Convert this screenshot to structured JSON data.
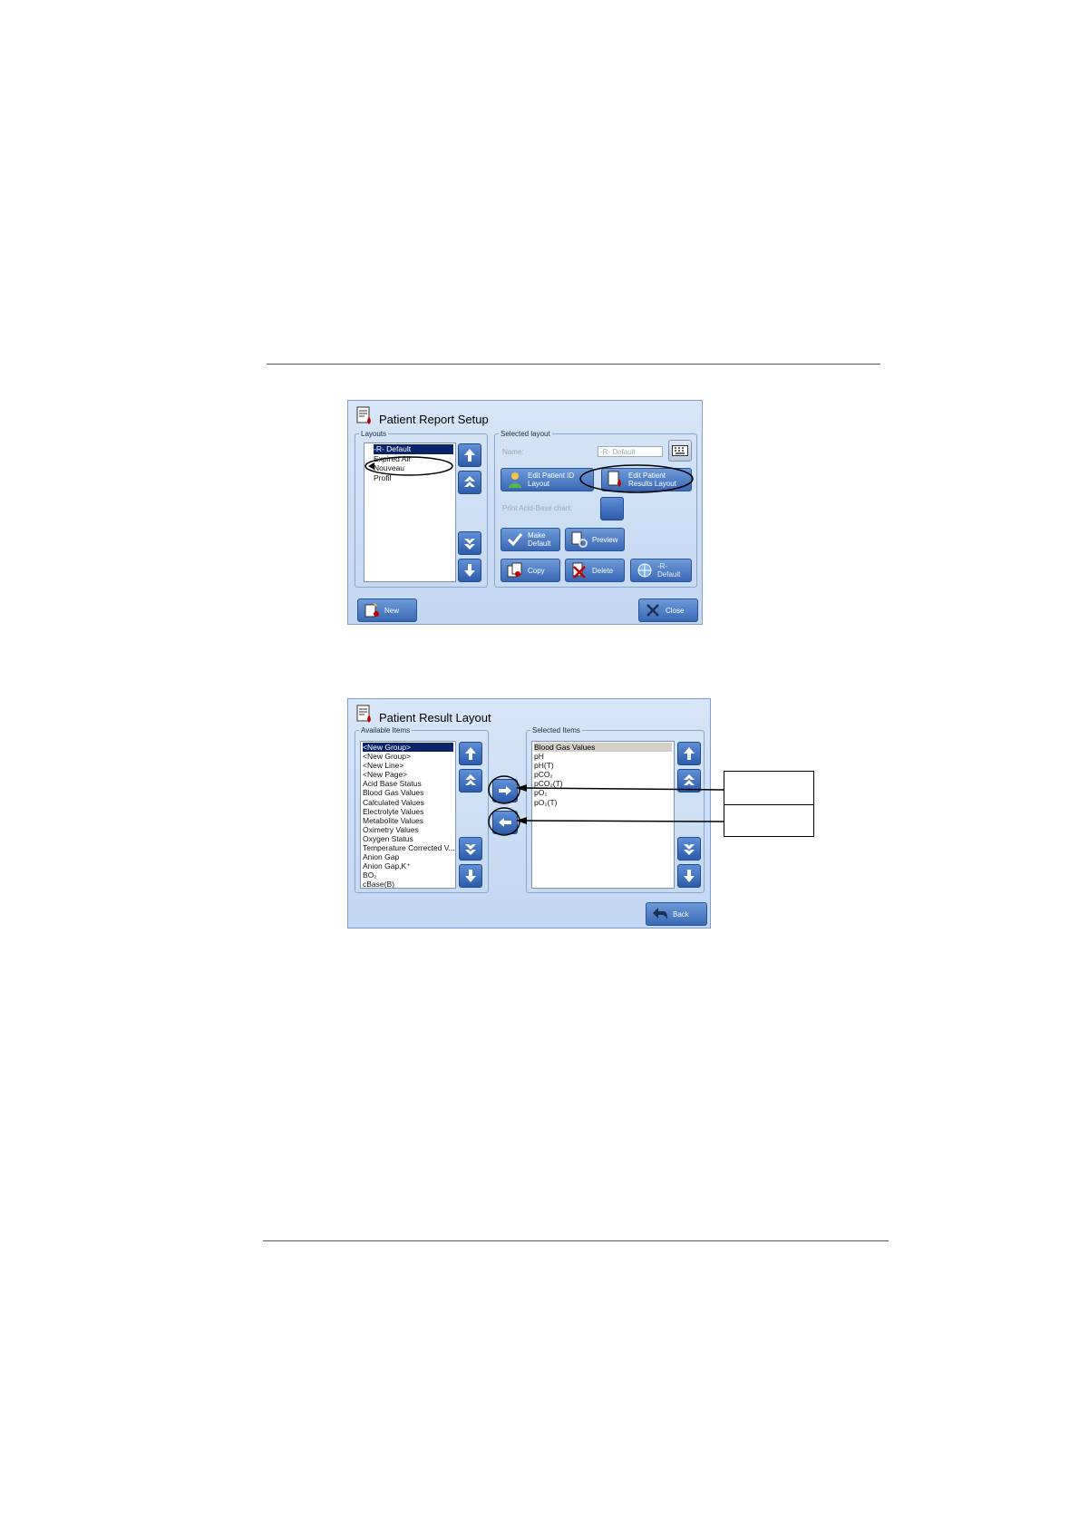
{
  "setup": {
    "title": "Patient Report Setup",
    "layouts_legend": "Layouts",
    "layouts": [
      "-R- Default",
      "Expired Air",
      "Nouveau",
      "Profil"
    ],
    "selected_legend": "Selected layout",
    "name_label": "Name:",
    "name_value": "-R- Default",
    "edit_patient_id": "Edit Patient ID Layout",
    "edit_patient_results": "Edit Patient Results Layout",
    "print_acid_base": "Print Acid-Base chart:",
    "make_default": "Make Default",
    "preview": "Preview",
    "copy": "Copy",
    "delete": "Delete",
    "r_default": "-R- Default",
    "new": "New",
    "close": "Close"
  },
  "result": {
    "title": "Patient Result Layout",
    "available_legend": "Available Items",
    "available": [
      "<New Group>",
      "<New Group>",
      "<New Line>",
      "<New Page>",
      "Acid Base Status",
      "Blood Gas Values",
      "Calculated Values",
      "Electrolyte Values",
      "Metabolite Values",
      "Oximetry Values",
      "Oxygen Status",
      "Temperature Corrected V...",
      "Anion Gap",
      "Anion Gap,K⁺",
      "BO₂",
      "cBase(B)"
    ],
    "selected_legend": "Selected Items",
    "selected": [
      "Blood Gas Values",
      "pH",
      "pH(T)",
      "pCO₂",
      "pCO₂(T)",
      "pO₂",
      "pO₂(T)"
    ],
    "back": "Back"
  },
  "colors": {
    "accent": "#3b68b5",
    "panel": "#c9dcf3",
    "selection": "#0a246a"
  }
}
